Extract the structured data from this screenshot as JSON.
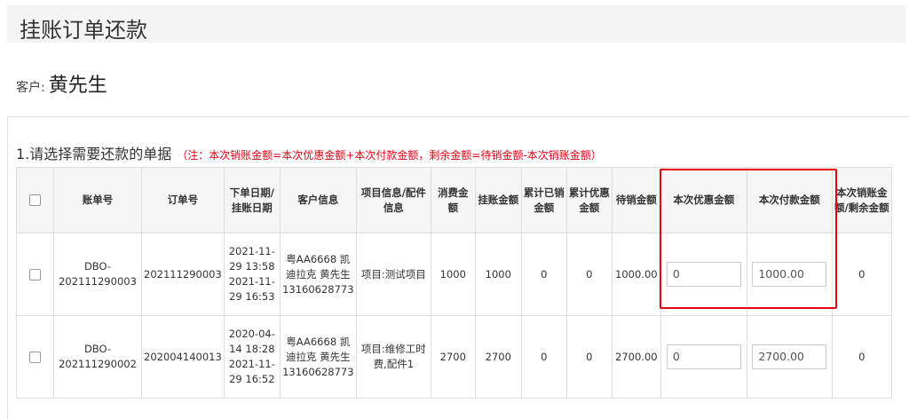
{
  "page": {
    "title": "挂账订单还款"
  },
  "customer": {
    "label": "客户:",
    "name": "黄先生"
  },
  "section": {
    "title": "1.请选择需要还款的单据",
    "note": "（注：本次销账金额=本次优惠金额+本次付款金额，剩余金额=待销金额-本次销账金额）"
  },
  "table": {
    "headers": [
      "",
      "账单号",
      "订单号",
      "下单日期/挂账日期",
      "客户信息",
      "项目信息/配件信息",
      "消费金额",
      "挂账金额",
      "累计已销金额",
      "累计优惠金额",
      "待销金额",
      "本次优惠金额",
      "本次付款金额",
      "本次销账金额/剩余金额"
    ],
    "rows": [
      {
        "bill_no": "DBO-202111290003",
        "order_no": "202111290003",
        "dates": "2021-11-29 13:58 2021-11-29 16:53",
        "customer": "粤AA6668 凯迪拉克 黄先生 13160628773",
        "project": "项目:测试项目",
        "consume": "1000",
        "credit": "1000",
        "paid_total": "0",
        "discount_total": "0",
        "pending": "1000.00",
        "discount_input": "0",
        "payment_input": "1000.00",
        "writeoff": "0"
      },
      {
        "bill_no": "DBO-202111290002",
        "order_no": "202004140013",
        "dates": "2020-04-14 18:28 2021-11-29 16:52",
        "customer": "粤AA6668 凯迪拉克 黄先生 13160628773",
        "project": "项目:维修工时费,配件1",
        "consume": "2700",
        "credit": "2700",
        "paid_total": "0",
        "discount_total": "0",
        "pending": "2700.00",
        "discount_input": "0",
        "payment_input": "2700.00",
        "writeoff": "0"
      }
    ]
  },
  "colors": {
    "accent_red": "#e60012",
    "header_bg": "#f5f5f5",
    "title_bg": "#f4f4f4"
  }
}
